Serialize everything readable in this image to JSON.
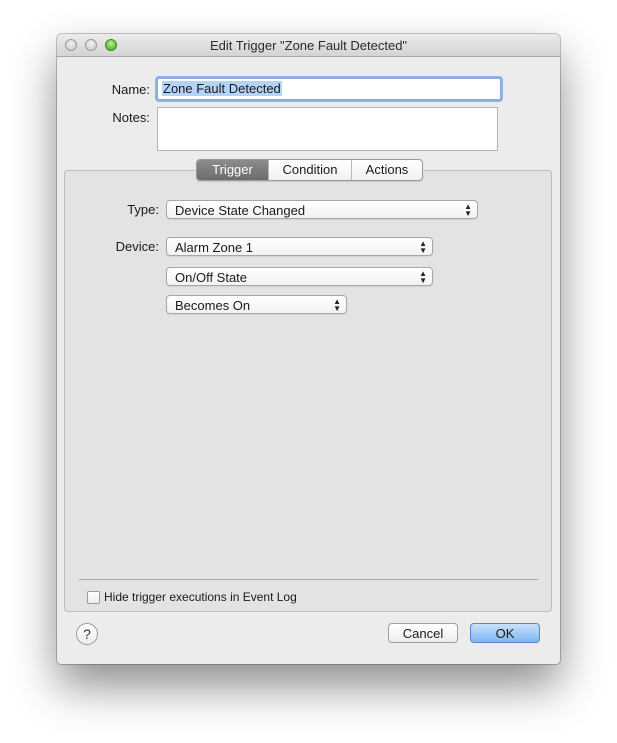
{
  "window": {
    "title": "Edit Trigger \"Zone Fault Detected\""
  },
  "form": {
    "name_label": "Name:",
    "name_value": "Zone Fault Detected",
    "notes_label": "Notes:",
    "notes_value": ""
  },
  "tabs": [
    {
      "label": "Trigger",
      "selected": true
    },
    {
      "label": "Condition",
      "selected": false
    },
    {
      "label": "Actions",
      "selected": false
    }
  ],
  "trigger": {
    "type_label": "Type:",
    "type_value": "Device State Changed",
    "device_label": "Device:",
    "device_value": "Alarm Zone 1",
    "state_value": "On/Off State",
    "change_value": "Becomes On"
  },
  "options": {
    "hide_label": "Hide trigger executions in Event Log",
    "hide_checked": false
  },
  "buttons": {
    "help_label": "?",
    "cancel_label": "Cancel",
    "ok_label": "OK"
  },
  "colors": {
    "default_button": "#7db6f2",
    "selected_tab": "#7c7c7c",
    "focus_ring": "#8db4ea",
    "zoom_button": "#3ea51b"
  },
  "icons": {
    "popup_arrows": "up-down-arrows",
    "help": "question-mark"
  }
}
